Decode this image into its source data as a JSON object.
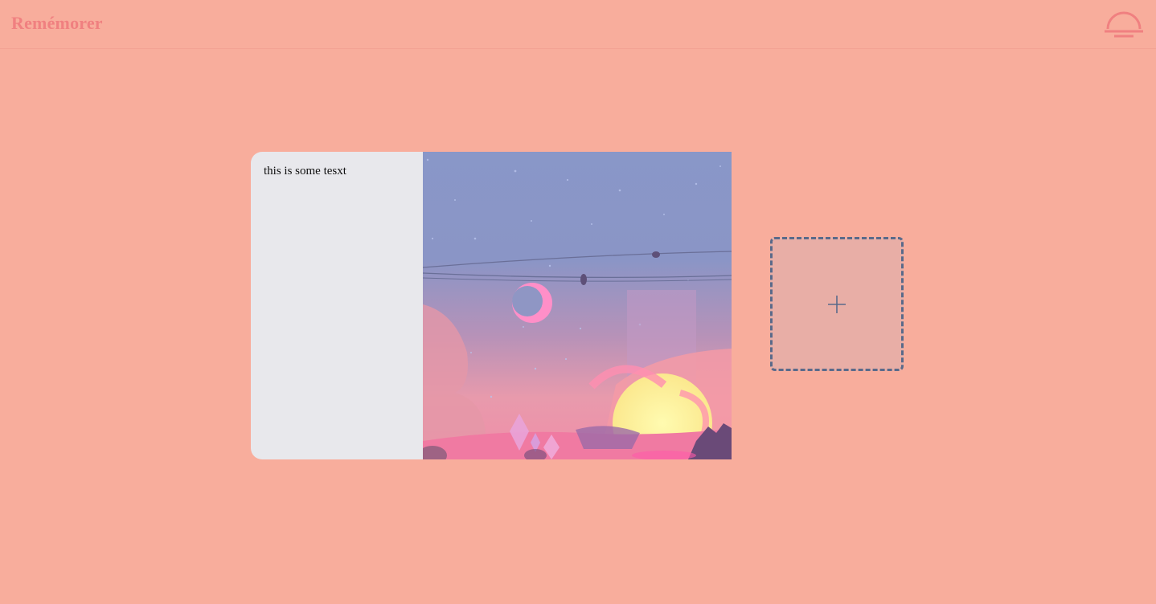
{
  "header": {
    "brand": "Remémorer",
    "menu_icon": "sunset-icon"
  },
  "note": {
    "text": "this is some tesxt",
    "image": "anime-sunset-landscape"
  },
  "add_card": {
    "icon": "plus-icon"
  },
  "colors": {
    "background": "#f8ad9c",
    "brand": "#f08080",
    "note_panel": "#e8e8ec",
    "add_border": "#5a6a8a"
  }
}
